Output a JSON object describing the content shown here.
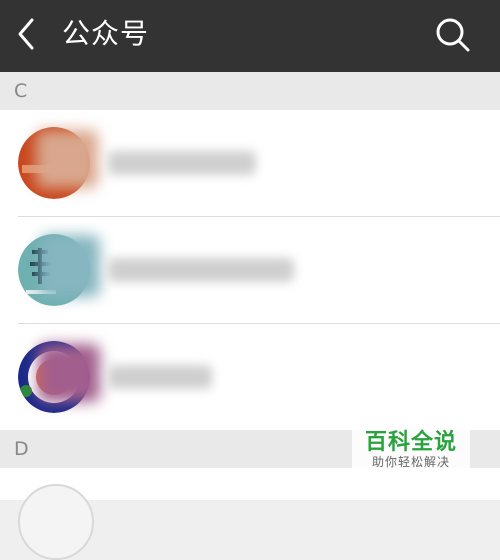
{
  "header": {
    "title": "公众号",
    "back_icon": "chevron-left-icon",
    "search_icon": "search-icon"
  },
  "sections": [
    {
      "letter": "C"
    },
    {
      "letter": "D"
    }
  ],
  "contacts": [
    {
      "name": "",
      "avatar": "orange-circle-logo"
    },
    {
      "name": "",
      "avatar": "teal-calligraphy-logo"
    },
    {
      "name": "",
      "avatar": "blue-ring-logo"
    }
  ],
  "watermark": {
    "main": "百科全说",
    "sub": "助你轻松解决"
  },
  "colors": {
    "topbar": "#333333",
    "background": "#efefef",
    "section_header": "#e9e9e9",
    "watermark_green": "#2aa33f"
  }
}
